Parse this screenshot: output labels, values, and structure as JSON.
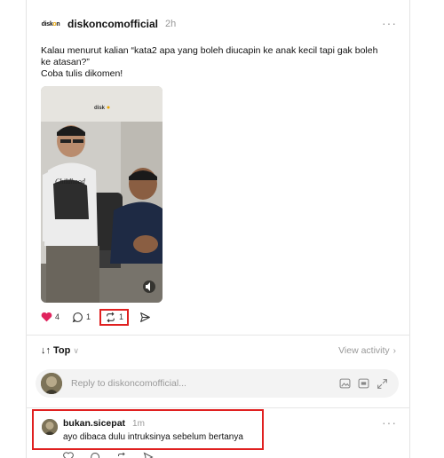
{
  "post": {
    "avatar_text_a": "disk",
    "avatar_text_b": "o",
    "avatar_text_c": "n",
    "username": "diskoncomofficial",
    "time": "2h",
    "more": "···",
    "caption_line1": "Kalau menurut kalian “kata2 apa yang boleh diucapin ke anak kecil tapi gak boleh",
    "caption_line2": "ke atasan?”",
    "caption_line3": "Coba tulis dikomen!",
    "video_wall_text": "disk",
    "shirt_text": "Childhood",
    "likes": "4",
    "comments": "1",
    "reposts": "1",
    "like_color": "#e0245e"
  },
  "sort": {
    "label": "Top",
    "arrows": "↓↑",
    "view_activity": "View activity",
    "chevron_right": "›",
    "chevron_down": "∨"
  },
  "reply": {
    "placeholder": "Reply to diskoncomofficial..."
  },
  "comment": {
    "username": "bukan.sicepat",
    "time": "1m",
    "text": "ayo dibaca dulu intruksinya sebelum bertanya",
    "more": "···"
  },
  "colors": {
    "highlight": "#e02020",
    "muted": "#999999"
  }
}
